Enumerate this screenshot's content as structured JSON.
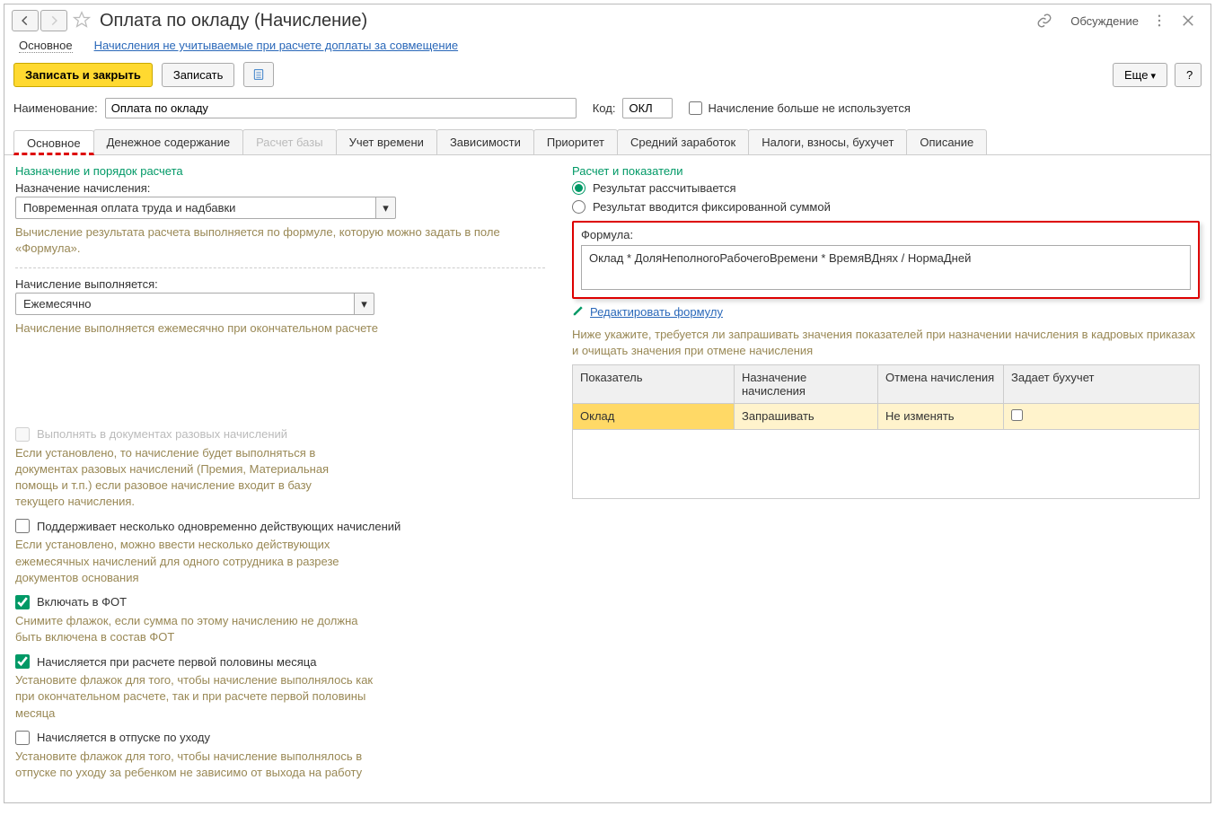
{
  "header": {
    "title": "Оплата по окладу (Начисление)",
    "discussion": "Обсуждение"
  },
  "navlinks": {
    "main": "Основное",
    "link1": "Начисления не учитываемые при расчете доплаты за совмещение"
  },
  "toolbar": {
    "save_close": "Записать и закрыть",
    "save": "Записать",
    "more": "Еще",
    "help": "?"
  },
  "fields": {
    "name_label": "Наименование:",
    "name_value": "Оплата по окладу",
    "code_label": "Код:",
    "code_value": "ОКЛ",
    "discontinued": "Начисление больше не используется"
  },
  "tabs": {
    "t1": "Основное",
    "t2": "Денежное содержание",
    "t3": "Расчет базы",
    "t4": "Учет времени",
    "t5": "Зависимости",
    "t6": "Приоритет",
    "t7": "Средний заработок",
    "t8": "Налоги, взносы, бухучет",
    "t9": "Описание"
  },
  "left": {
    "section1": "Назначение и порядок расчета",
    "purpose_label": "Назначение начисления:",
    "purpose_value": "Повременная оплата труда и надбавки",
    "purpose_hint": "Вычисление результата расчета выполняется по формуле, которую можно задать в поле «Формула».",
    "executes_label": "Начисление выполняется:",
    "executes_value": "Ежемесячно",
    "executes_hint": "Начисление выполняется ежемесячно при окончательном расчете",
    "chk_oneoff": "Выполнять в документах разовых начислений",
    "chk_oneoff_hint": "Если установлено, то начисление будет выполняться в документах разовых начислений (Премия, Материальная помощь и т.п.) если разовое начисление входит в базу текущего начисления.",
    "chk_multi": "Поддерживает несколько одновременно действующих начислений",
    "chk_multi_hint": "Если установлено, можно ввести несколько действующих ежемесячных начислений для одного сотрудника в разрезе документов основания",
    "chk_fot": "Включать в ФОТ",
    "chk_fot_hint": "Снимите флажок, если сумма по этому начислению не должна быть включена в состав ФОТ",
    "chk_firsthalf": "Начисляется при расчете первой половины месяца",
    "chk_firsthalf_hint": "Установите флажок для того, чтобы начисление выполнялось как при окончательном расчете, так и при расчете первой половины месяца",
    "chk_leave": "Начисляется в отпуске по уходу",
    "chk_leave_hint": "Установите флажок для того, чтобы начисление выполнялось в отпуске по уходу за ребенком не зависимо от выхода на работу"
  },
  "right": {
    "section1": "Расчет и показатели",
    "radio1": "Результат рассчитывается",
    "radio2": "Результат вводится фиксированной суммой",
    "formula_label": "Формула:",
    "formula_value": "Оклад * ДоляНеполногоРабочегоВремени * ВремяВДнях / НормаДней",
    "edit_formula": "Редактировать формулу",
    "table_hint": "Ниже укажите, требуется ли запрашивать значения показателей при назначении начисления в кадровых приказах и очищать значения при отмене начисления",
    "th1": "Показатель",
    "th2": "Назначение начисления",
    "th3": "Отмена начисления",
    "th4": "Задает бухучет",
    "row1_c1": "Оклад",
    "row1_c2": "Запрашивать",
    "row1_c3": "Не изменять"
  }
}
